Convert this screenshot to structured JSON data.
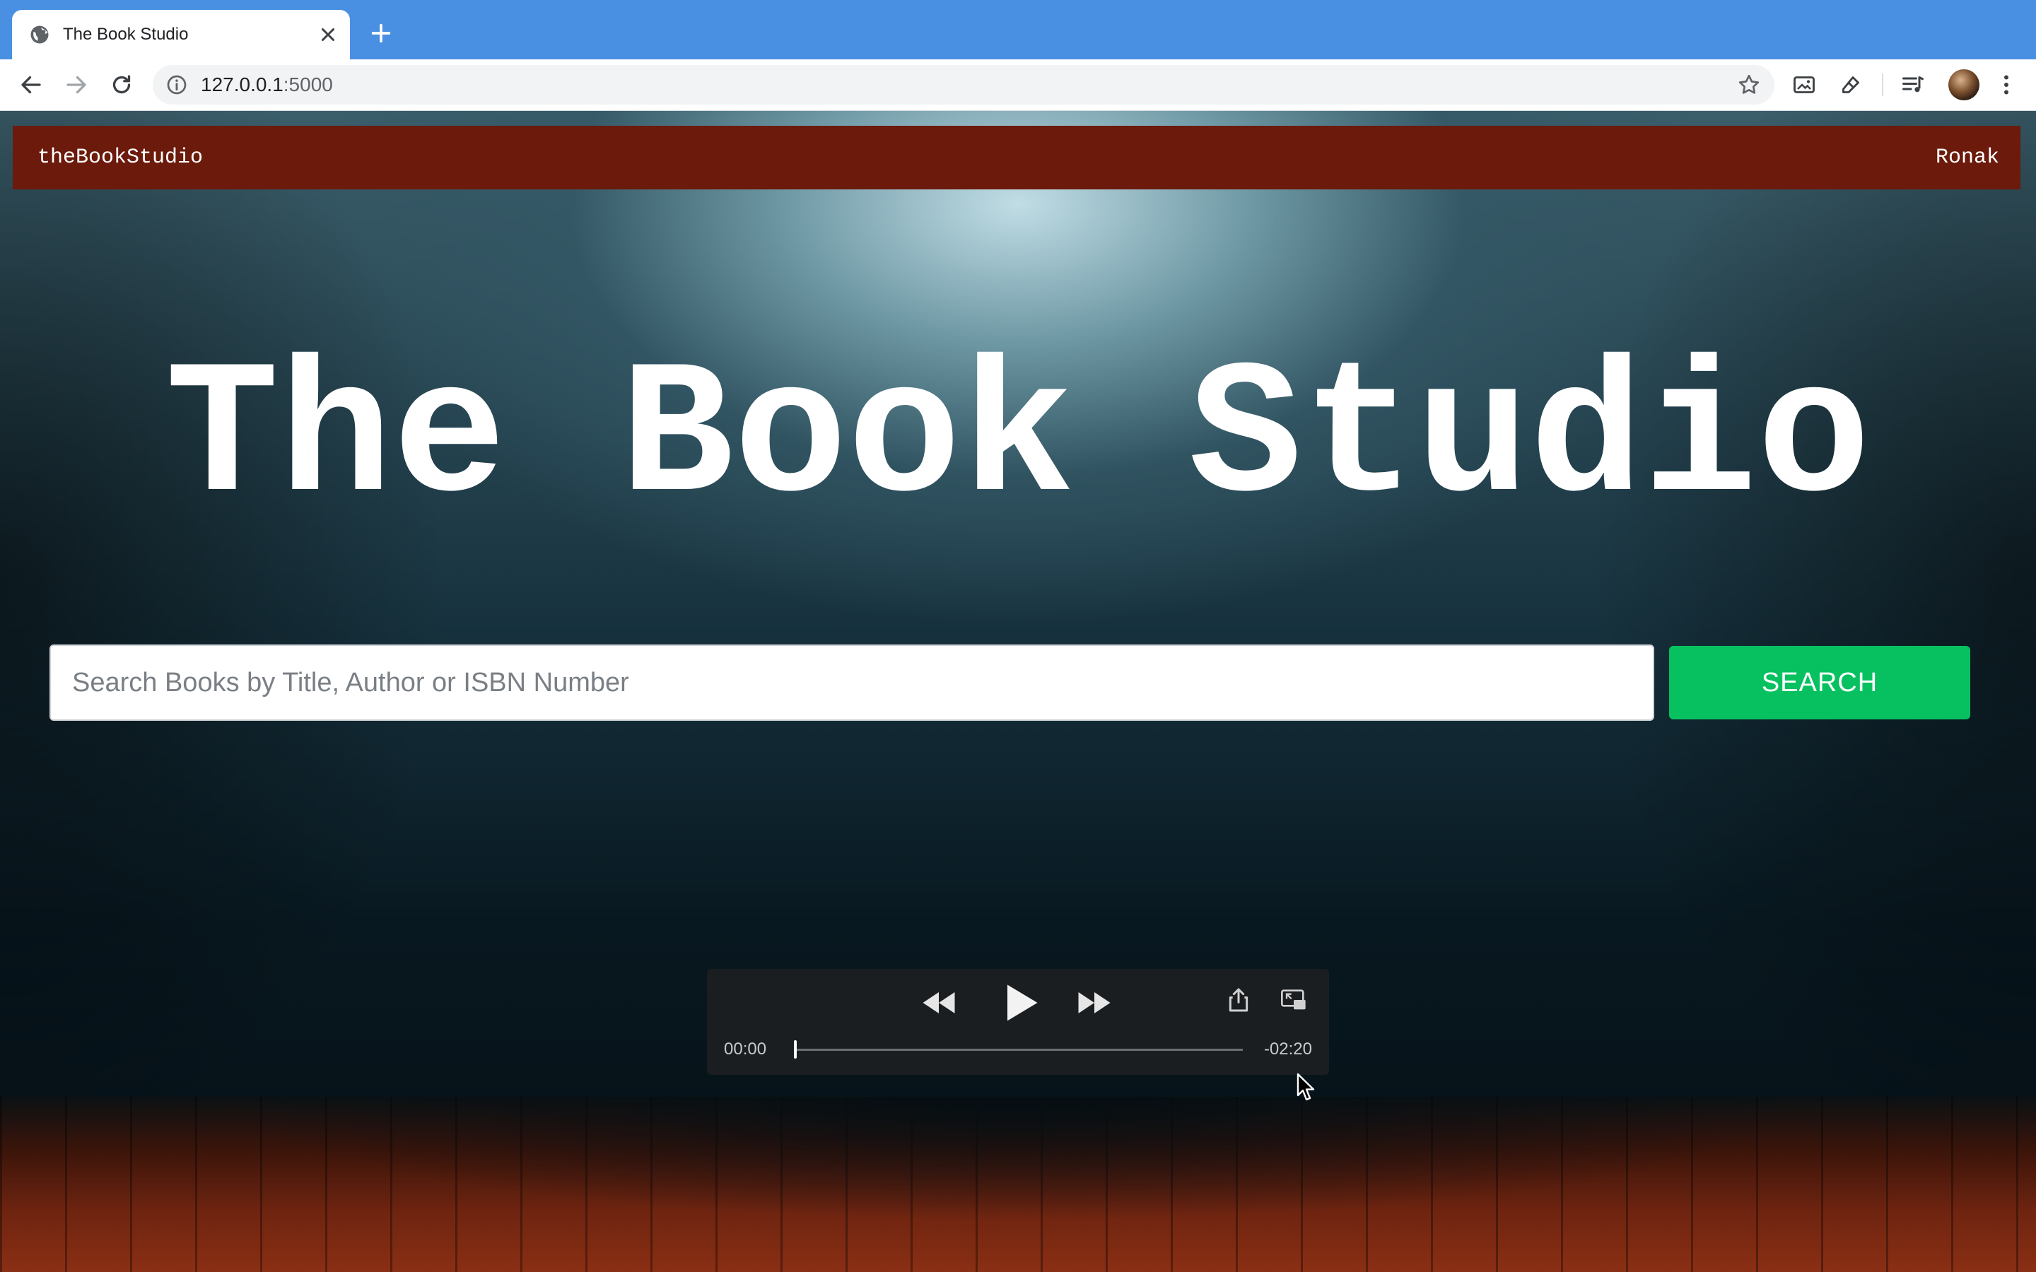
{
  "browser": {
    "tab": {
      "title": "The Book Studio",
      "favicon": "globe-icon"
    },
    "address": {
      "host": "127.0.0.1",
      "port": ":5000"
    },
    "toolbar_icons": [
      "back-icon",
      "forward-icon",
      "reload-icon",
      "info-icon",
      "star-icon",
      "screenshot-icon",
      "extension-icon",
      "media-queue-icon",
      "avatar",
      "more-icon"
    ]
  },
  "navbar": {
    "brand": "theBookStudio",
    "user": "Ronak",
    "background": "#6b1a0b"
  },
  "hero": {
    "title": "The Book Studio"
  },
  "search": {
    "placeholder": "Search Books by Title, Author or ISBN Number",
    "value": "",
    "button_label": "SEARCH",
    "button_color": "#07c160"
  },
  "media_player": {
    "elapsed": "00:00",
    "remaining": "-02:20",
    "progress": 0,
    "icons": [
      "rewind-icon",
      "play-icon",
      "fast-forward-icon",
      "share-icon",
      "picture-in-picture-icon"
    ]
  }
}
